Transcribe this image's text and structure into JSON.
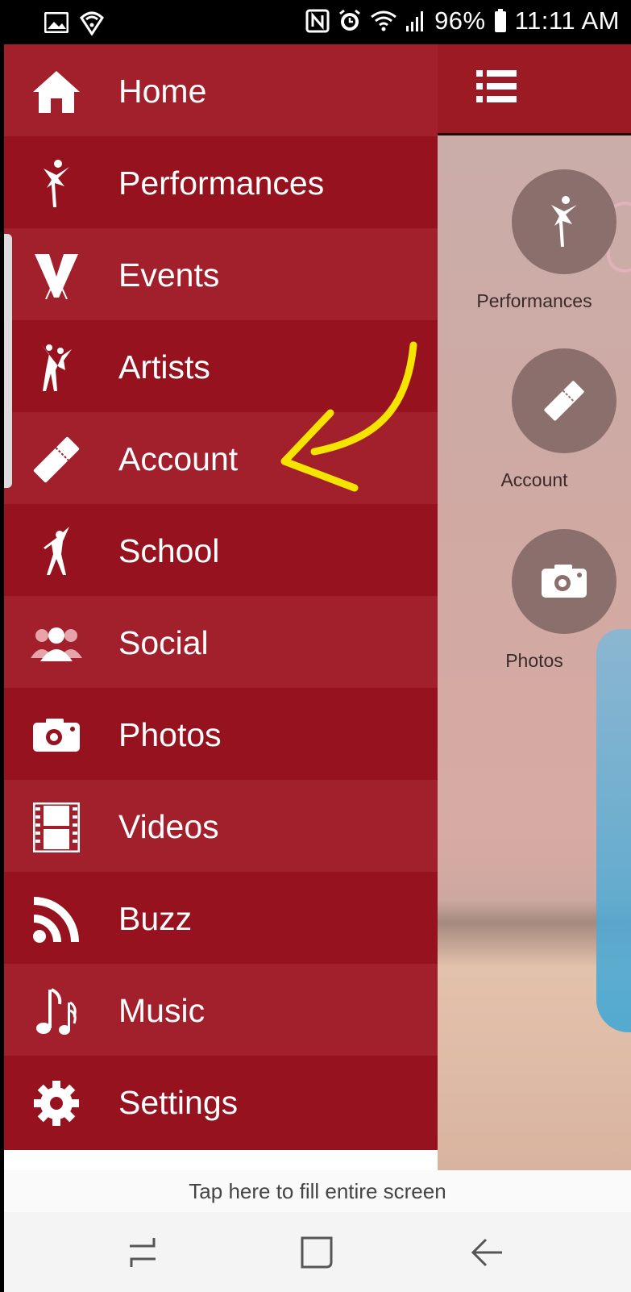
{
  "status_bar": {
    "battery": "96%",
    "time": "11:11 AM",
    "left_icons": [
      "image-icon",
      "wifi-shield-icon"
    ],
    "right_icons": [
      "nfc-icon",
      "alarm-icon",
      "wifi-icon",
      "signal-icon",
      "battery-icon"
    ]
  },
  "drawer": {
    "items": [
      {
        "label": "Home",
        "icon": "home-icon"
      },
      {
        "label": "Performances",
        "icon": "ballerina-icon"
      },
      {
        "label": "Events",
        "icon": "events-v-icon"
      },
      {
        "label": "Artists",
        "icon": "dancing-couple-icon"
      },
      {
        "label": "Account",
        "icon": "ticket-icon"
      },
      {
        "label": "School",
        "icon": "dancer-icon"
      },
      {
        "label": "Social",
        "icon": "people-icon"
      },
      {
        "label": "Photos",
        "icon": "camera-icon"
      },
      {
        "label": "Videos",
        "icon": "film-icon"
      },
      {
        "label": "Buzz",
        "icon": "rss-icon"
      },
      {
        "label": "Music",
        "icon": "music-notes-icon"
      },
      {
        "label": "Settings",
        "icon": "gear-icon"
      }
    ]
  },
  "main": {
    "header_icon": "list-menu-icon",
    "tiles": [
      {
        "label": "Performances",
        "icon": "ballerina-icon"
      },
      {
        "label": "Account",
        "icon": "ticket-icon"
      },
      {
        "label": "Photos",
        "icon": "camera-icon"
      }
    ]
  },
  "banner": {
    "text": "Tap here to fill entire screen"
  },
  "nav": {
    "buttons": [
      "recents-icon",
      "home-square-icon",
      "back-arrow-icon"
    ]
  },
  "colors": {
    "drawer_light": "#a21f2c",
    "drawer_dark": "#95121e",
    "header": "#9c1a24",
    "annotation_arrow": "#f5e400"
  }
}
